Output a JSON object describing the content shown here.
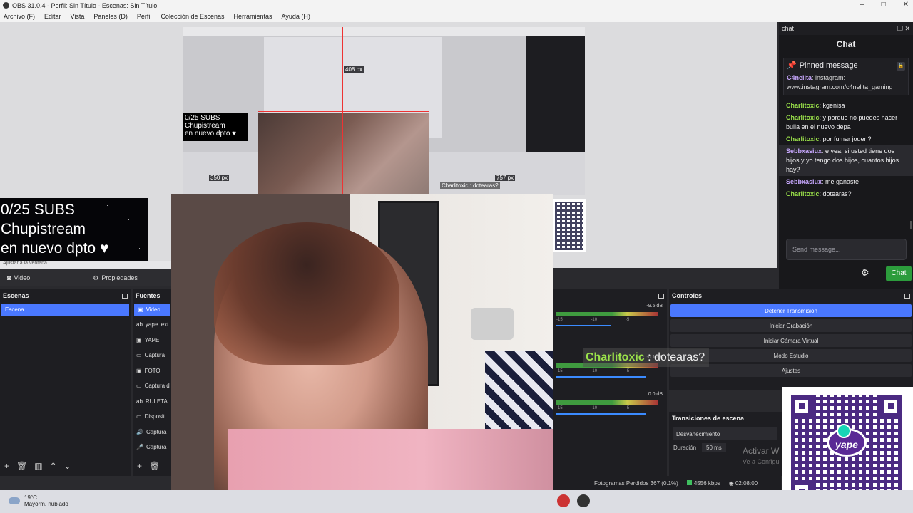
{
  "window": {
    "title": "OBS 31.0.4 - Perfil: Sin Título - Escenas: Sin Título",
    "min": "–",
    "max": "□",
    "close": "✕"
  },
  "menu": [
    "Archivo (F)",
    "Editar",
    "Vista",
    "Paneles (D)",
    "Perfil",
    "Colección de Escenas",
    "Herramientas",
    "Ayuda (H)"
  ],
  "preview": {
    "px_top": "408 px",
    "px_left": "350 px",
    "px_right": "757 px",
    "mini_subs": "0/25 SUBS\nChupistream\nen nuevo dpto ♥",
    "mini_chat": "Charlitoxic : dotearas?"
  },
  "overlay": {
    "subs_line1": "0/25 SUBS",
    "subs_line2": "Chupistream",
    "subs_line3": "en nuevo dpto ♥",
    "fit_label": "Ajustar a la ventana"
  },
  "scene_toolbar": {
    "source_name": "Video",
    "properties": "Propiedades"
  },
  "scenes": {
    "title": "Escenas",
    "items": [
      "Escena"
    ]
  },
  "sources": {
    "title": "Fuentes",
    "items": [
      {
        "icon": "▣",
        "label": "Video"
      },
      {
        "icon": "ab",
        "label": "yape text"
      },
      {
        "icon": "▣",
        "label": "YAPE"
      },
      {
        "icon": "▭",
        "label": "Captura"
      },
      {
        "icon": "▣",
        "label": "FOTO"
      },
      {
        "icon": "▭",
        "label": "Captura d"
      },
      {
        "icon": "ab",
        "label": "RULETA"
      },
      {
        "icon": "▭",
        "label": "Disposit"
      },
      {
        "icon": "🔊",
        "label": "Captura"
      },
      {
        "icon": "🎤",
        "label": "Captura"
      }
    ]
  },
  "mixer": {
    "channels": [
      {
        "db": "-9.5 dB",
        "fader": 0.55
      },
      {
        "db": "-0.1 dB",
        "fader": 0.9
      },
      {
        "db": "0.0 dB",
        "fader": 0.9
      }
    ]
  },
  "controls": {
    "title": "Controles",
    "buttons": [
      {
        "label": "Detener Transmisión",
        "active": true
      },
      {
        "label": "Iniciar Grabación",
        "active": false
      },
      {
        "label": "Iniciar Cámara Virtual",
        "active": false
      },
      {
        "label": "Modo Estudio",
        "active": false
      },
      {
        "label": "Ajustes",
        "active": false
      }
    ]
  },
  "transitions": {
    "title": "Transiciones de escena",
    "selected": "Desvanecimiento",
    "duration_label": "Duración",
    "duration_value": "50 ms"
  },
  "activate": {
    "line1": "Activar W",
    "line2": "Ve a Configu"
  },
  "status": {
    "dropped": "Fotogramas Perdidos 367 (0.1%)",
    "bitrate": "4556 kbps",
    "time": "02:08:00"
  },
  "chat_overlay": {
    "user": "Charlitoxic",
    "text": " : dotearas?"
  },
  "chat": {
    "dock_title": "chat",
    "header": "Chat",
    "pinned_title": "Pinned message",
    "pinned_user": "C4nelita",
    "pinned_text": ": instagram: www.instagram.com/c4nelita_gaming",
    "messages": [
      {
        "user": "Charlitoxic",
        "text": ": kgenisa",
        "kind": "u1"
      },
      {
        "user": "Charlitoxic",
        "text": ": y porque no puedes hacer bulla en el nuevo depa",
        "kind": "u1"
      },
      {
        "user": "Charlitoxic",
        "text": ": por fumar joden?",
        "kind": "u1"
      },
      {
        "user": "Sebbxasiux",
        "text": ": e vea, si usted tiene dos hijos y yo tengo dos hijos, cuantos hijos hay?",
        "kind": "u2"
      },
      {
        "user": "Sebbxasiux",
        "text": ": me ganaste",
        "kind": "u2"
      },
      {
        "user": "Charlitoxic",
        "text": ": dotearas?",
        "kind": "u1"
      }
    ],
    "input_placeholder": "Send message...",
    "send_label": "Chat"
  },
  "yape": {
    "label": "yape"
  },
  "weather": {
    "temp": "19°C",
    "desc": "Mayorm. nublado"
  }
}
